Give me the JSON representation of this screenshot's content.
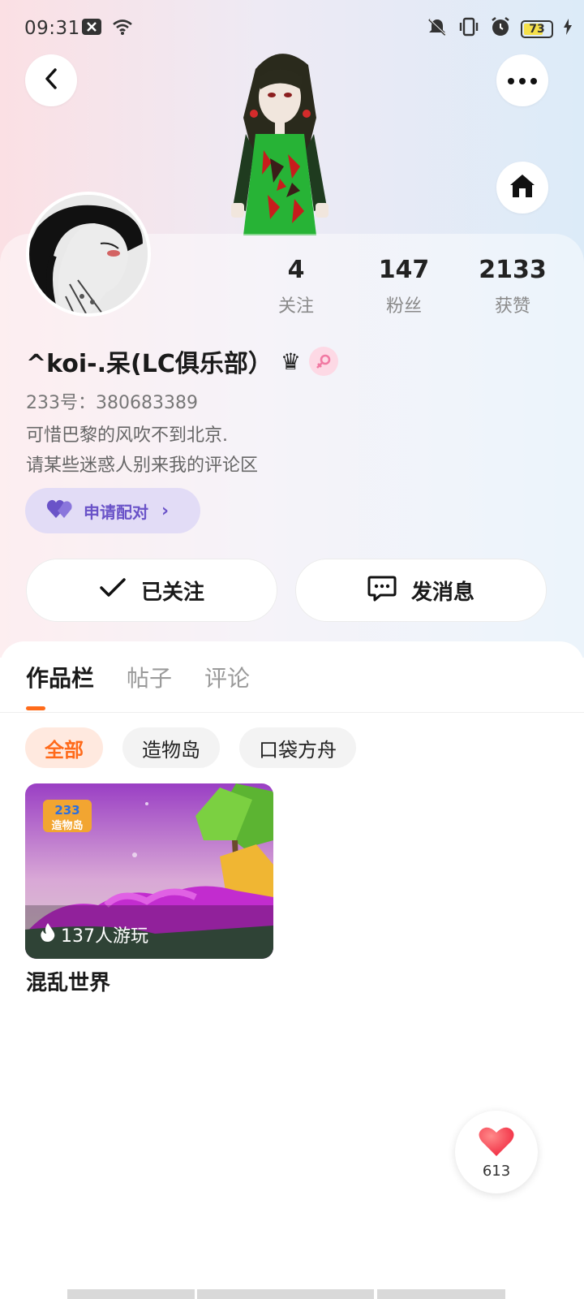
{
  "status_bar": {
    "time": "09:31",
    "battery": "73",
    "battery_level": 0.73,
    "icons": [
      "notification-x-icon",
      "wifi-icon",
      "mute-icon",
      "vibrate-icon",
      "alarm-icon",
      "battery-icon",
      "charging-icon"
    ]
  },
  "header": {
    "icons": [
      "back-icon",
      "more-icon",
      "home-icon"
    ]
  },
  "profile": {
    "stats": [
      {
        "value": "4",
        "label": "关注"
      },
      {
        "value": "147",
        "label": "粉丝"
      },
      {
        "value": "2133",
        "label": "获赞"
      }
    ],
    "username": "^koi-.呆(LC俱乐部）",
    "badges": [
      "crown-icon",
      "female-icon"
    ],
    "id_text": "233号：380683389",
    "bio_lines": [
      "可惜巴黎的风吹不到北京.",
      "请某些迷惑人别来我的评论区"
    ],
    "pair_button": "申请配对",
    "follow_button": "已关注",
    "message_button": "发消息"
  },
  "tabs": [
    {
      "label": "作品栏",
      "active": true
    },
    {
      "label": "帖子",
      "active": false
    },
    {
      "label": "评论",
      "active": false
    }
  ],
  "filters": [
    {
      "label": "全部",
      "active": true
    },
    {
      "label": "造物岛",
      "active": false
    },
    {
      "label": "口袋方舟",
      "active": false
    }
  ],
  "works": [
    {
      "title": "混乱世界",
      "plays": "137人游玩",
      "logo_text": "233\n造物岛"
    }
  ],
  "like_fab": {
    "count": "613"
  },
  "colors": {
    "accent": "#ff6a1a",
    "pair_purple": "#6a53c8",
    "pair_bg": "#e2dcf6"
  }
}
